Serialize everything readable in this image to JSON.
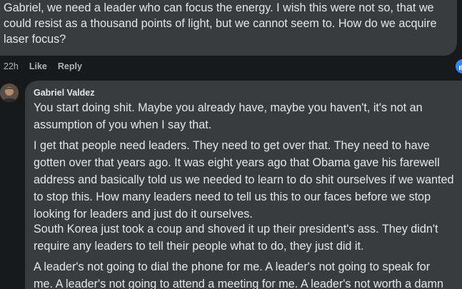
{
  "top_comment": {
    "text": "Gabriel, we need a leader who can focus the energy. I wish this were not so, that we\ncould resist as a thousand points of light, but we cannot seem to. How do we acquire\nlaser focus?",
    "time": "22h",
    "like_label": "Like",
    "reply_label": "Reply"
  },
  "reply": {
    "author": "Gabriel Valdez",
    "paragraphs": [
      "You start doing shit. Maybe you already have, maybe you haven't, it's not an\nassumption of you when I say that.",
      "I get that people need leaders. They need to get over that. They need to have\ngotten over that years ago. It was eight years ago that Obama gave his farewell\naddress and basically told us we needed to learn to do shit ourselves if we wanted\nto stop this. How many leaders need to tell us this to our faces before we stop\nlooking for leaders and just do it ourselves.",
      "South Korea just took a coup and shoved it up their president's ass. They didn't\nrequire any leaders to tell their people what to do, they just did it.",
      "A leader's not going to dial the phone for me. A leader's not going to speak for\nme. A leader's not going to attend a meeting for me. A leader's not worth a damn"
    ]
  },
  "colors": {
    "background": "#18191a",
    "bubble": "#3a3b3c",
    "text": "#e4e6eb",
    "secondary_text": "#b0b3b8",
    "like_blue": "#2d88ff"
  },
  "icons": {
    "reaction": "thumbs-up-icon"
  }
}
